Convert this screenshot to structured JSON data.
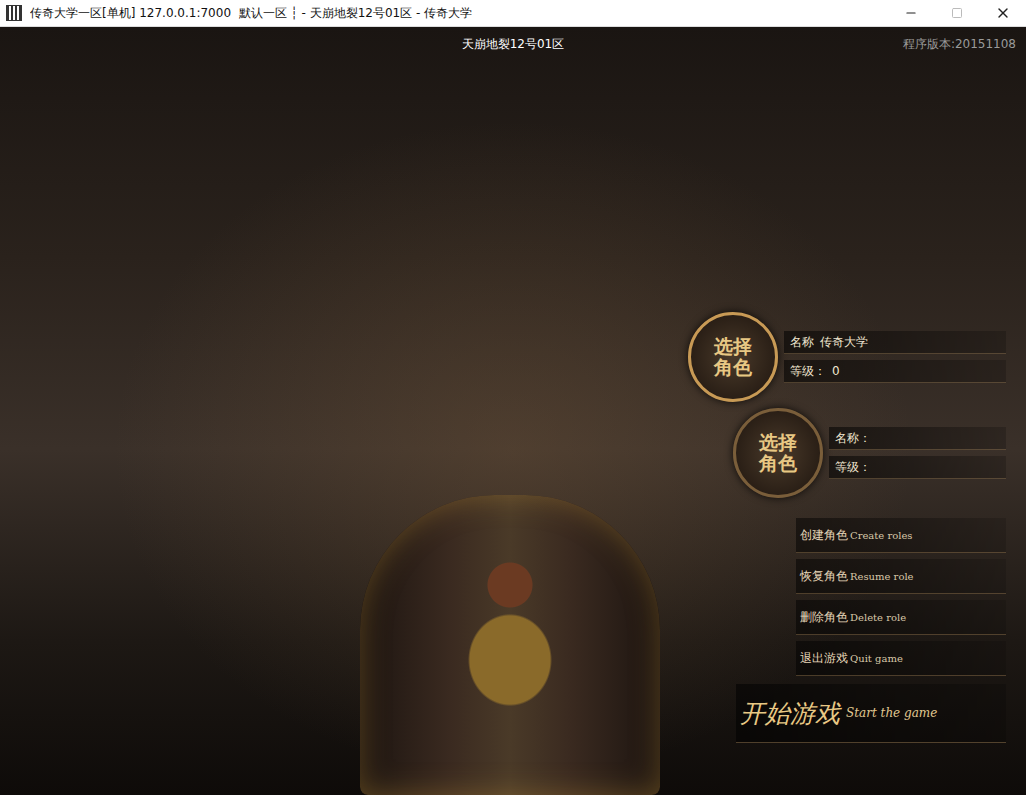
{
  "window": {
    "title": "传奇大学一区[单机] 127.0.0.1:7000  默认一区 ┆ - 天崩地裂12号01区 - 传奇大学"
  },
  "header": {
    "server": "天崩地裂12号01区",
    "version": "程序版本:20151108"
  },
  "roles": [
    {
      "button": "选择角色",
      "name_label": "名称",
      "name": "传奇大学",
      "level_label": "等级：",
      "level": "0",
      "selected": true
    },
    {
      "button": "选择角色",
      "name_label": "名称：",
      "name": "",
      "level_label": "等级：",
      "level": "",
      "selected": false
    }
  ],
  "menu": [
    {
      "label": "创建角色",
      "sub": "Create roles"
    },
    {
      "label": "恢复角色",
      "sub": "Resume role"
    },
    {
      "label": "删除角色",
      "sub": "Delete role"
    },
    {
      "label": "退出游戏",
      "sub": "Quit game"
    }
  ],
  "start": {
    "label": "开始游戏",
    "sub": "Start the game"
  }
}
